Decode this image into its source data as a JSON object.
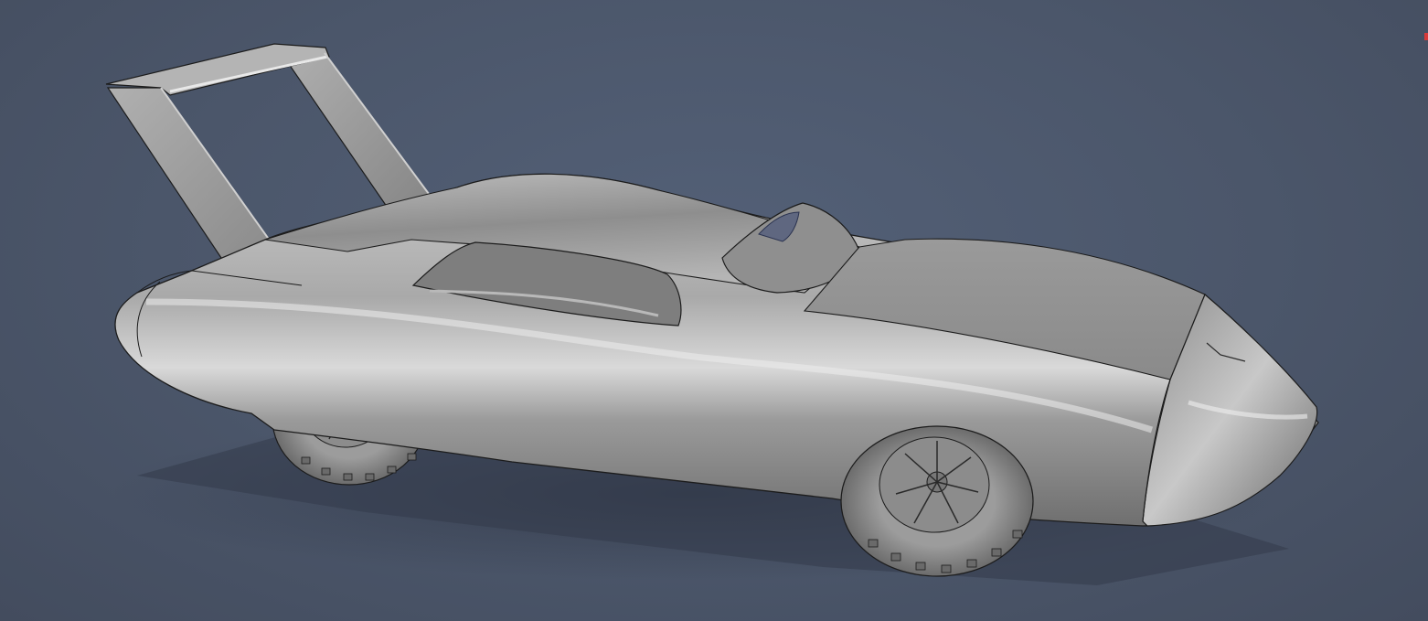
{
  "viewport": {
    "background_color": "#4a5467",
    "model_color": "#9e9e9e",
    "edge_color": "#1c1c1c",
    "axis_indicator_color": "#d63a3a"
  },
  "model": {
    "parts": [
      "rear-wing",
      "body",
      "rear-window",
      "canopy",
      "hood",
      "nose-cone",
      "rear-wheel",
      "front-wheel"
    ]
  }
}
